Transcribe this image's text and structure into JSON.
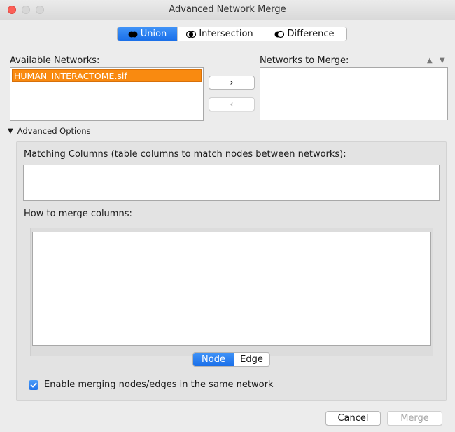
{
  "window": {
    "title": "Advanced Network Merge"
  },
  "mode_segments": [
    {
      "label": "Union",
      "active": true,
      "icon": "union-icon"
    },
    {
      "label": "Intersection",
      "active": false,
      "icon": "intersection-icon"
    },
    {
      "label": "Difference",
      "active": false,
      "icon": "difference-icon"
    }
  ],
  "available_networks": {
    "label": "Available Networks:",
    "items": [
      "HUMAN_INTERACTOME.sif"
    ],
    "selected_index": 0
  },
  "networks_to_merge": {
    "label": "Networks to Merge:",
    "items": []
  },
  "transfer_buttons": {
    "add": "›",
    "remove": "‹"
  },
  "advanced_options": {
    "label": "Advanced Options",
    "matching_columns_label": "Matching Columns (table columns to match nodes between networks):",
    "merge_columns_label": "How to merge columns:",
    "table_toggle": [
      {
        "label": "Node",
        "active": true
      },
      {
        "label": "Edge",
        "active": false
      }
    ],
    "enable_same_network_label": "Enable merging nodes/edges in the same network",
    "enable_same_network_checked": true
  },
  "footer": {
    "cancel_label": "Cancel",
    "merge_label": "Merge"
  },
  "colors": {
    "accent": "#1a6fe9",
    "selection": "#f98a10",
    "close_button": "#fc5f57"
  }
}
